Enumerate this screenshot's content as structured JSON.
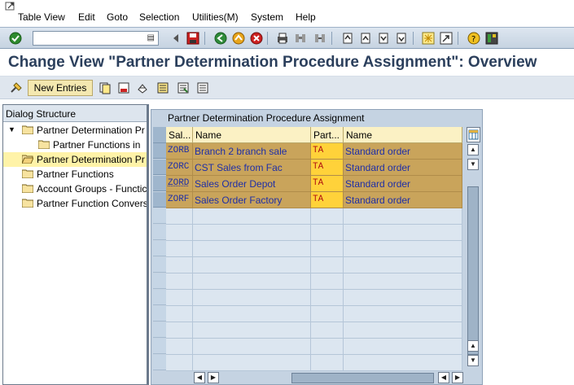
{
  "menu": {
    "items": [
      "Table View",
      "Edit",
      "Goto",
      "Selection",
      "Utilities(M)",
      "System",
      "Help"
    ]
  },
  "toolbar": {
    "command_field_value": ""
  },
  "title": "Change View \"Partner Determination Procedure Assignment\": Overview",
  "app_toolbar": {
    "new_entries_label": "New Entries"
  },
  "tree": {
    "header": "Dialog Structure",
    "nodes": [
      {
        "label": "Partner Determination Pr",
        "level": 0,
        "expanded": true
      },
      {
        "label": "Partner Functions in",
        "level": 1
      },
      {
        "label": "Partner Determination Pr",
        "level": 0,
        "selected": true
      },
      {
        "label": "Partner Functions",
        "level": 0
      },
      {
        "label": "Account Groups - Functic",
        "level": 0
      },
      {
        "label": "Partner Function Convers",
        "level": 0
      }
    ]
  },
  "table": {
    "title": "Partner Determination Procedure Assignment",
    "columns": [
      "Sal...",
      "Name",
      "Part...",
      "Name"
    ],
    "rows": [
      [
        "ZORB",
        "Branch 2 branch sale",
        "TA",
        "Standard order"
      ],
      [
        "ZORC",
        "CST Sales from Fac",
        "TA",
        "Standard order"
      ],
      [
        "ZORD",
        "Sales Order Depot",
        "TA",
        "Standard order"
      ],
      [
        "ZORF",
        "Sales Order Factory",
        "TA",
        "Standard order"
      ]
    ],
    "empty_rows": 10
  },
  "colors": {
    "filled_row": "#c9a45b",
    "partner_cell": "#ffd23a",
    "title_text": "#2b3f5c",
    "selected_tree_node": "#fff3a8"
  }
}
